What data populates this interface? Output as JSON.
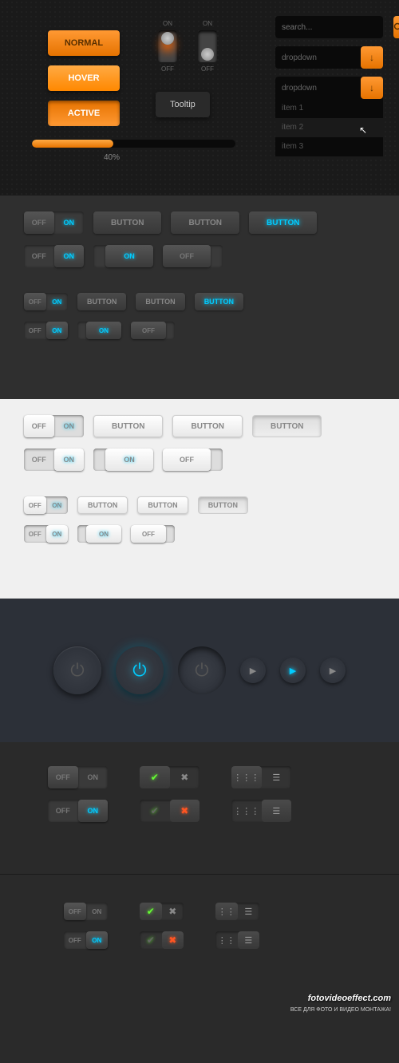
{
  "section1": {
    "buttons": {
      "normal": "NORMAL",
      "hover": "HOVER",
      "active": "ACTIVE"
    },
    "switch_labels": {
      "on": "ON",
      "off": "OFF"
    },
    "tooltip": "Tooltip",
    "search": {
      "placeholder": "search..."
    },
    "dropdown1": {
      "label": "dropdown"
    },
    "dropdown2": {
      "label": "dropdown",
      "items": [
        "item 1",
        "item 2",
        "item 3"
      ]
    },
    "progress": {
      "value": 40,
      "label": "40%"
    }
  },
  "section2": {
    "off": "OFF",
    "on": "ON",
    "button": "BUTTON"
  },
  "section3": {
    "off": "OFF",
    "on": "ON",
    "button": "BUTTON"
  },
  "watermark": {
    "site": "fotovideoeffect.com",
    "tagline": "ВСЕ ДЛЯ ФОТО И ВИДЕО МОНТАЖА!"
  }
}
